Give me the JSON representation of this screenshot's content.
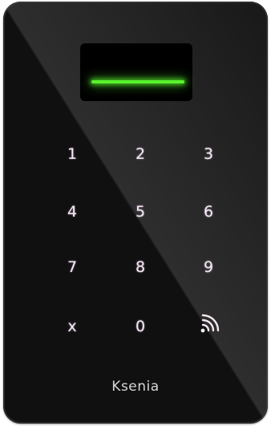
{
  "keypad": {
    "keys": [
      "1",
      "2",
      "3",
      "4",
      "5",
      "6",
      "7",
      "8",
      "9",
      "x",
      "0"
    ],
    "nfc_icon": "contactless-icon"
  },
  "indicator": {
    "color": "#59f22f",
    "state": "on"
  },
  "brand": {
    "name": "Ksenia"
  }
}
